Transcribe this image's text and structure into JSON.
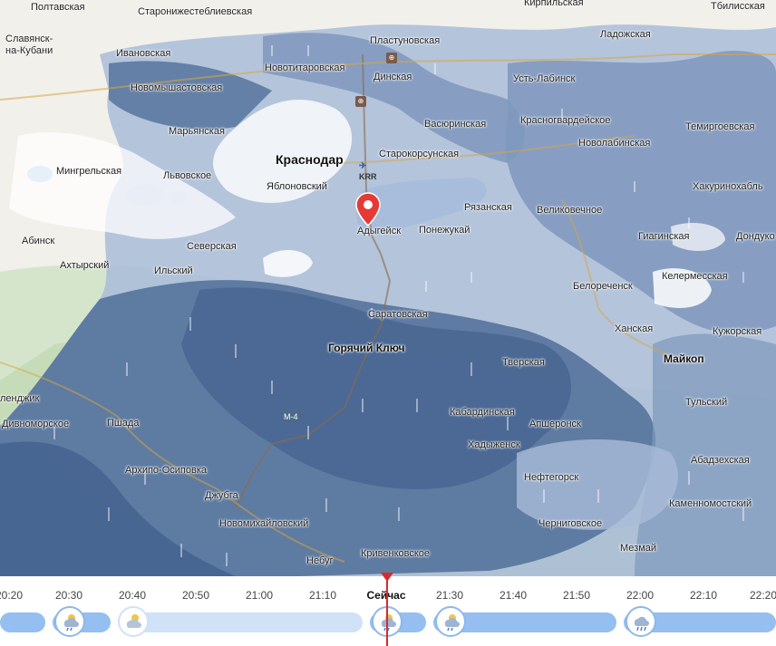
{
  "map": {
    "places": [
      {
        "id": "poltavskaya",
        "label": "Полтавская"
      },
      {
        "id": "staronizhesteblievskaya",
        "label": "Старонижестеблиевская"
      },
      {
        "id": "kirpilskaya",
        "label": "Кирпильская"
      },
      {
        "id": "tbilisskaya",
        "label": "Тбилисская"
      },
      {
        "id": "slavyansk",
        "label": "Славянск-\nна-Кубани"
      },
      {
        "id": "ivanovskaya",
        "label": "Ивановская"
      },
      {
        "id": "plastunovskaya",
        "label": "Пластуновская"
      },
      {
        "id": "ladozhskaya",
        "label": "Ладожская"
      },
      {
        "id": "novotitarovskaya",
        "label": "Новотитаровская"
      },
      {
        "id": "dinskaya",
        "label": "Динская"
      },
      {
        "id": "ust_labinsk",
        "label": "Усть-Лабинск"
      },
      {
        "id": "novomyshastovskaya",
        "label": "Новомышастовская"
      },
      {
        "id": "vasyurinskaya",
        "label": "Васюринская"
      },
      {
        "id": "krasnogvardeyskoe",
        "label": "Красногвардейское"
      },
      {
        "id": "temirgoevskaya",
        "label": "Темиргоевская"
      },
      {
        "id": "maryanskaya",
        "label": "Марьянская"
      },
      {
        "id": "novolabinskaya",
        "label": "Новолабинская"
      },
      {
        "id": "krasnodar",
        "label": "Краснодар"
      },
      {
        "id": "starokorsunskaya",
        "label": "Старокорсунская"
      },
      {
        "id": "mingrelskaya",
        "label": "Мингрельская"
      },
      {
        "id": "lvovskoe",
        "label": "Львовское"
      },
      {
        "id": "yablonovsky",
        "label": "Яблоновский"
      },
      {
        "id": "khakurinokhabl",
        "label": "Хакуринохабль"
      },
      {
        "id": "ryazanskaya",
        "label": "Рязанская"
      },
      {
        "id": "velikovechnoe",
        "label": "Великовечное"
      },
      {
        "id": "adygeysk",
        "label": "Адыгейск"
      },
      {
        "id": "ponezhukay",
        "label": "Понежукай"
      },
      {
        "id": "abinsk",
        "label": "Абинск"
      },
      {
        "id": "giaginskaya",
        "label": "Гиагинская"
      },
      {
        "id": "dondukovskaya",
        "label": "Дондуко"
      },
      {
        "id": "severskaya",
        "label": "Северская"
      },
      {
        "id": "akhtyrsky",
        "label": "Ахтырский"
      },
      {
        "id": "ilsky",
        "label": "Ильский"
      },
      {
        "id": "kelermesskaya",
        "label": "Келермесская"
      },
      {
        "id": "belorechensk",
        "label": "Белореченск"
      },
      {
        "id": "saratovskaya",
        "label": "Саратовская"
      },
      {
        "id": "khanskaya",
        "label": "Ханская"
      },
      {
        "id": "kuzhorskaya",
        "label": "Кужорская"
      },
      {
        "id": "goryachy_klyuch",
        "label": "Горячий Ключ"
      },
      {
        "id": "maykop",
        "label": "Майкоп"
      },
      {
        "id": "tverskaya",
        "label": "Тверская"
      },
      {
        "id": "gelendzhik",
        "label": "ленджик"
      },
      {
        "id": "tulsky",
        "label": "Тульский"
      },
      {
        "id": "kabardinskaya",
        "label": "Кабардинская"
      },
      {
        "id": "divnomorskoe",
        "label": "Дивноморское"
      },
      {
        "id": "pshada",
        "label": "Пшада"
      },
      {
        "id": "apsheronsk",
        "label": "Апшеронск"
      },
      {
        "id": "khadyzhensk",
        "label": "Хадыженск"
      },
      {
        "id": "abadzekhskaya",
        "label": "Абадзехская"
      },
      {
        "id": "arkhipo_osipovka",
        "label": "Архипо-Осиповка"
      },
      {
        "id": "neftegorsk",
        "label": "Нефтегорск"
      },
      {
        "id": "dzhubga",
        "label": "Джубга"
      },
      {
        "id": "kamennomostsky",
        "label": "Каменномостский"
      },
      {
        "id": "novomikhaylovsky",
        "label": "Новомихайловский"
      },
      {
        "id": "cherniogovskoe",
        "label": "Черниговское"
      },
      {
        "id": "mezmay",
        "label": "Мезмай"
      },
      {
        "id": "nebug",
        "label": "Небуг"
      },
      {
        "id": "krivenkovskoe",
        "label": "Кривенковское"
      }
    ],
    "road_label": "M-4",
    "airport_code": "KRR",
    "colors": {
      "precip_light": "#a9bcd8",
      "precip_mid": "#7f98bd",
      "precip_dark": "#506f99",
      "precip_darkest": "#3f5e8a",
      "pin": "#e53935"
    }
  },
  "timeline": {
    "ticks": [
      "20:20",
      "20:30",
      "20:40",
      "20:50",
      "21:00",
      "21:10",
      "Сейчас",
      "21:30",
      "21:40",
      "21:50",
      "22:00",
      "22:10",
      "22:20"
    ],
    "now_label": "Сейчас",
    "icons": [
      "cloud-rain-icon",
      "cloud-sun-icon",
      "cloud-rain-icon",
      "cloud-rain-icon",
      "cloud-rain-icon"
    ]
  }
}
